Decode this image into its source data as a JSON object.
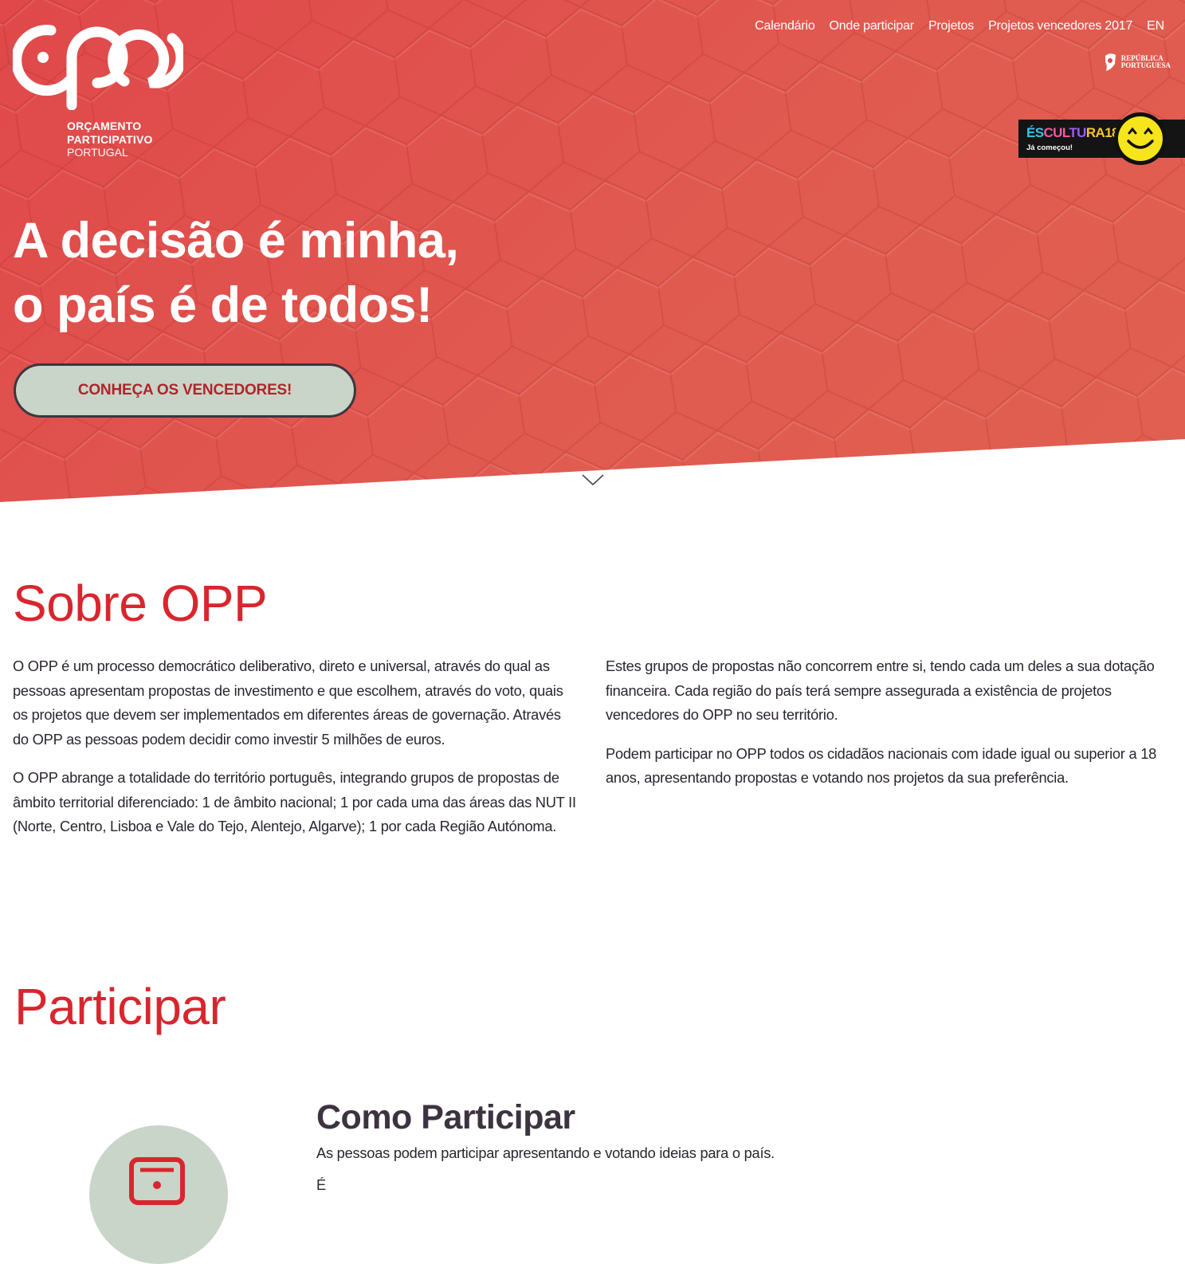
{
  "brand": {
    "logo_line1": "ORÇAMENTO",
    "logo_line2": "PARTICIPATIVO",
    "logo_line3": "PORTUGAL"
  },
  "nav": {
    "items": [
      {
        "label": "Calendário"
      },
      {
        "label": "Onde participar"
      },
      {
        "label": "Projetos"
      },
      {
        "label": "Projetos vencedores 2017"
      },
      {
        "label": "EN"
      }
    ]
  },
  "gov_badge": {
    "line1": "REPÚBLICA",
    "line2": "PORTUGUESA"
  },
  "promo": {
    "title_part1": "ÉS",
    "title_part2": "CUL",
    "title_part3": "TU",
    "title_part4": "RA18",
    "subtitle": "Já começou!"
  },
  "hero": {
    "headline_line1": "A decisão é minha,",
    "headline_line2": "o país é de todos!",
    "cta_label": "CONHEÇA OS VENCEDORES!"
  },
  "sobre": {
    "title": "Sobre OPP",
    "left_paragraphs": [
      "O OPP é um processo democrático deliberativo, direto e universal, através do qual as pessoas apresentam propostas de investimento e que escolhem, através do voto, quais os projetos que devem ser implementados em diferentes áreas de governação. Através do OPP as pessoas podem decidir como investir 5 milhões de euros.",
      "O OPP abrange a totalidade do território português, integrando grupos de propostas de âmbito territorial diferenciado: 1 de âmbito nacional; 1 por cada uma das áreas das NUT II (Norte, Centro, Lisboa e Vale do Tejo, Alentejo, Algarve); 1 por cada Região Autónoma."
    ],
    "right_paragraphs": [
      "Estes grupos de propostas não concorrem entre si, tendo cada um deles a sua dotação financeira. Cada região do país terá sempre assegurada a existência de projetos vencedores do OPP no seu território.",
      "Podem participar no OPP todos os cidadãos nacionais com idade igual ou superior a 18 anos, apresentando propostas e votando nos projetos da sua preferência."
    ]
  },
  "participar": {
    "title": "Participar",
    "como_title": "Como Participar",
    "como_text": "As pessoas podem participar apresentando e votando ideias para o país.",
    "como_more": "É"
  },
  "colors": {
    "hero_red": "#e0484a",
    "accent_red": "#d8262e",
    "sage": "#c9d5c8",
    "dark": "#3d3340"
  }
}
